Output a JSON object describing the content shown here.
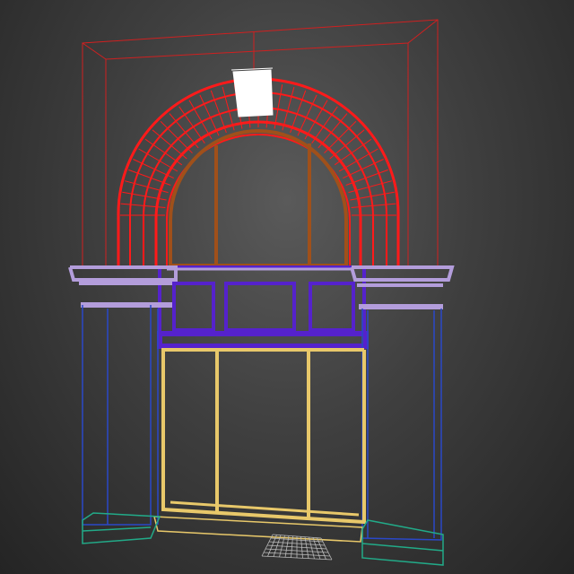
{
  "viewport": {
    "background_center": "#5a5a5a",
    "background_edge": "#242424"
  },
  "scene": {
    "objects": [
      {
        "id": "bounding-frame",
        "color": "#d02020"
      },
      {
        "id": "arch-molding",
        "color": "#ff1a1a"
      },
      {
        "id": "arch-window-frame",
        "color": "#a0501a"
      },
      {
        "id": "keystone",
        "color": "#ffffff"
      },
      {
        "id": "cornice",
        "color": "#b39ddb"
      },
      {
        "id": "transom-panel",
        "color": "#5522cc"
      },
      {
        "id": "pilasters",
        "color": "#2a48c8"
      },
      {
        "id": "door-frame",
        "color": "#e8c86a"
      },
      {
        "id": "plinths",
        "color": "#22aa88"
      },
      {
        "id": "doormat",
        "color": "#bbbbbb"
      }
    ]
  }
}
